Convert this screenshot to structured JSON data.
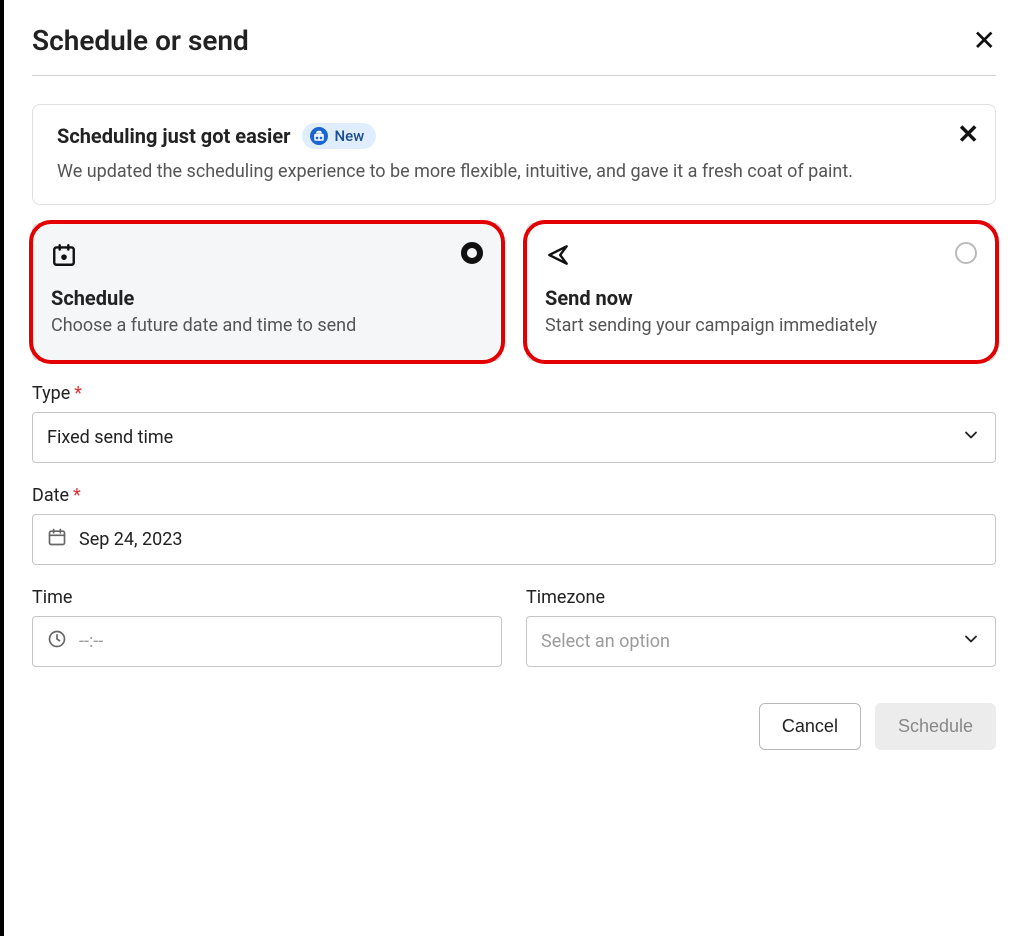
{
  "header": {
    "title": "Schedule or send"
  },
  "notice": {
    "title": "Scheduling just got easier",
    "badge_label": "New",
    "body": "We updated the scheduling experience to be more flexible, intuitive, and gave it a fresh coat of paint."
  },
  "options": {
    "schedule": {
      "title": "Schedule",
      "desc": "Choose a future date and time to send"
    },
    "send_now": {
      "title": "Send now",
      "desc": "Start sending your campaign immediately"
    }
  },
  "form": {
    "type_label": "Type",
    "type_value": "Fixed send time",
    "date_label": "Date",
    "date_value": "Sep 24, 2023",
    "time_label": "Time",
    "time_placeholder": "--:--",
    "timezone_label": "Timezone",
    "timezone_placeholder": "Select an option"
  },
  "footer": {
    "cancel": "Cancel",
    "schedule": "Schedule"
  }
}
